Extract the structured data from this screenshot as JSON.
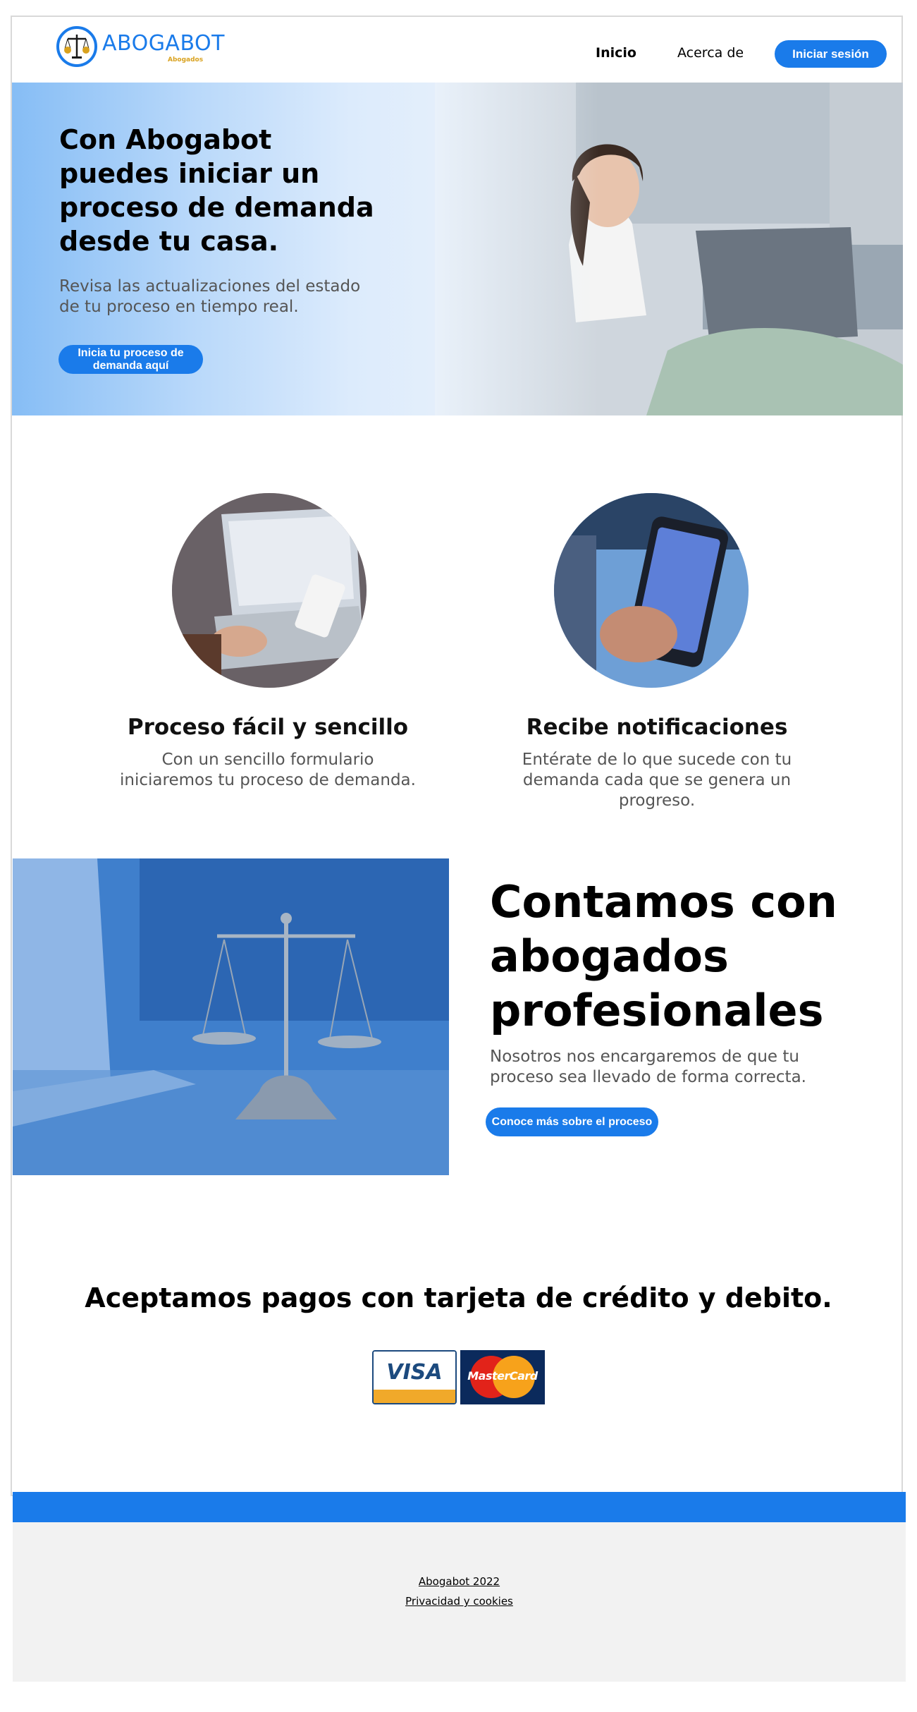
{
  "header": {
    "brand": "ABOGABOT",
    "brand_sub": "Abogados",
    "nav": {
      "inicio": "Inicio",
      "acerca": "Acerca de"
    },
    "login_label": "Iniciar sesión"
  },
  "hero": {
    "title": "Con Abogabot puedes iniciar un proceso de demanda desde tu casa.",
    "subtitle": "Revisa las actualizaciones del estado de tu proceso en tiempo real.",
    "cta": "Inicia tu proceso de demanda aquí"
  },
  "features": [
    {
      "title": "Proceso fácil y sencillo",
      "text": "Con un sencillo formulario iniciaremos tu proceso de demanda."
    },
    {
      "title": "Recibe notificaciones",
      "text": "Entérate de lo que sucede con tu demanda cada que se genera un progreso."
    }
  ],
  "lawyers": {
    "title": "Contamos con abogados profesionales",
    "subtitle": "Nosotros nos encargaremos de que tu proceso sea llevado de forma correcta.",
    "cta": "Conoce más sobre el proceso"
  },
  "payments": {
    "title": "Aceptamos pagos con tarjeta de crédito y debito.",
    "visa": "VISA",
    "mastercard": "MasterCard"
  },
  "footer": {
    "copyright": "Abogabot 2022",
    "privacy": "Privacidad y cookies"
  },
  "colors": {
    "accent": "#1a7bea",
    "logo_gold": "#d9a21f",
    "footer_bg": "#f2f2f2"
  }
}
